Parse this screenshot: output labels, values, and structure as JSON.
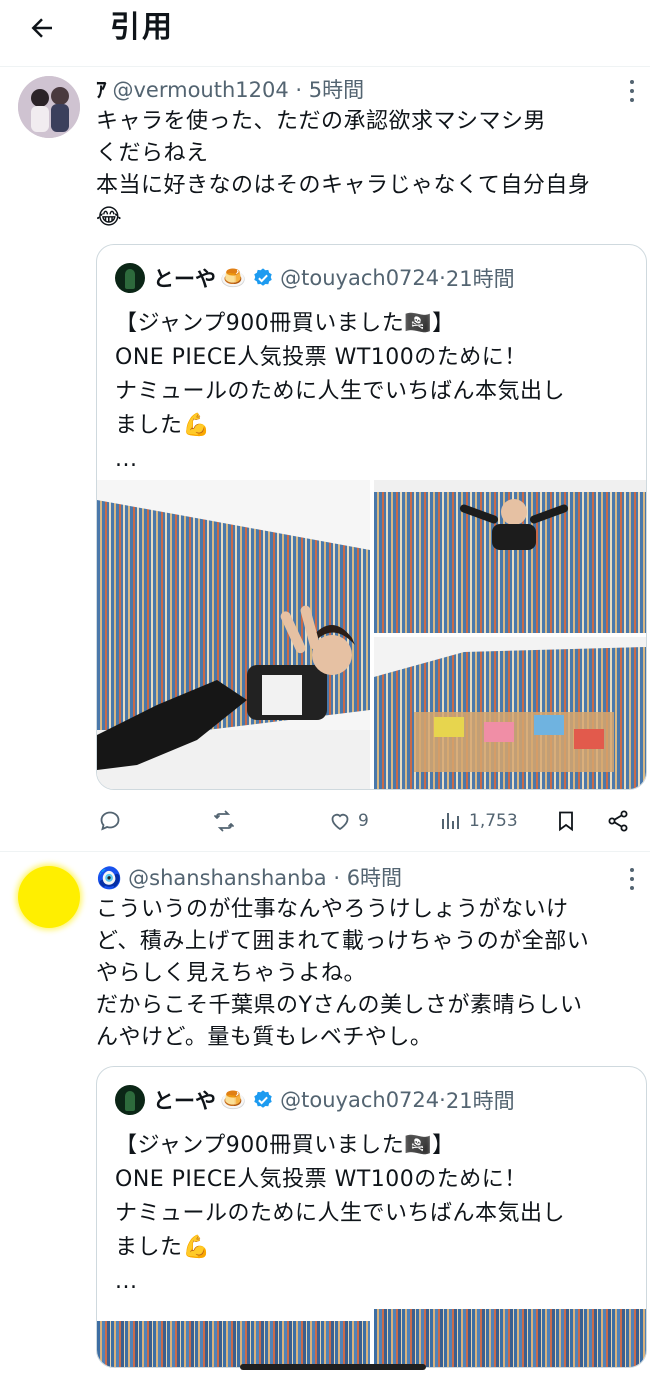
{
  "header": {
    "title": "引用"
  },
  "tweets": [
    {
      "display_name": "ｱ",
      "handle": "@vermouth1204",
      "time": "5時間",
      "lines": [
        "キャラを使った、ただの承認欲求マシマシ男",
        "くだらねえ",
        "本当に好きなのはそのキャラじゃなくて自分自身",
        "😂"
      ],
      "quote": {
        "name": "とーや",
        "emoji": "🍮",
        "handle": "@touyach0724",
        "time": "21時間",
        "lines": [
          "【ジャンプ900冊買いました🏴‍☠️】",
          "ONE PIECE人気投票 WT100のために！",
          "ナミュールのために人生でいちばん本気出し",
          "ました💪",
          "..."
        ]
      },
      "actions": {
        "reply": "",
        "retweet": "",
        "like": "9",
        "views": "1,753"
      }
    },
    {
      "display_name": "🧿",
      "handle": "@shanshanshanba",
      "time": "6時間",
      "lines": [
        "こういうのが仕事なんやろうけしょうがないけ",
        "ど、積み上げて囲まれて載っけちゃうのが全部い",
        "やらしく見えちゃうよね。",
        "だからこそ千葉県のYさんの美しさが素晴らしい",
        "んやけど。量も質もレベチやし。"
      ],
      "quote": {
        "name": "とーや",
        "emoji": "🍮",
        "handle": "@touyach0724",
        "time": "21時間",
        "lines": [
          "【ジャンプ900冊買いました🏴‍☠️】",
          "ONE PIECE人気投票 WT100のために！",
          "ナミュールのために人生でいちばん本気出し",
          "ました💪",
          "..."
        ]
      }
    }
  ],
  "colors": {
    "text": "#0f1419",
    "secondary": "#536471",
    "verified": "#1d9bf0",
    "border": "#cfd9de"
  }
}
